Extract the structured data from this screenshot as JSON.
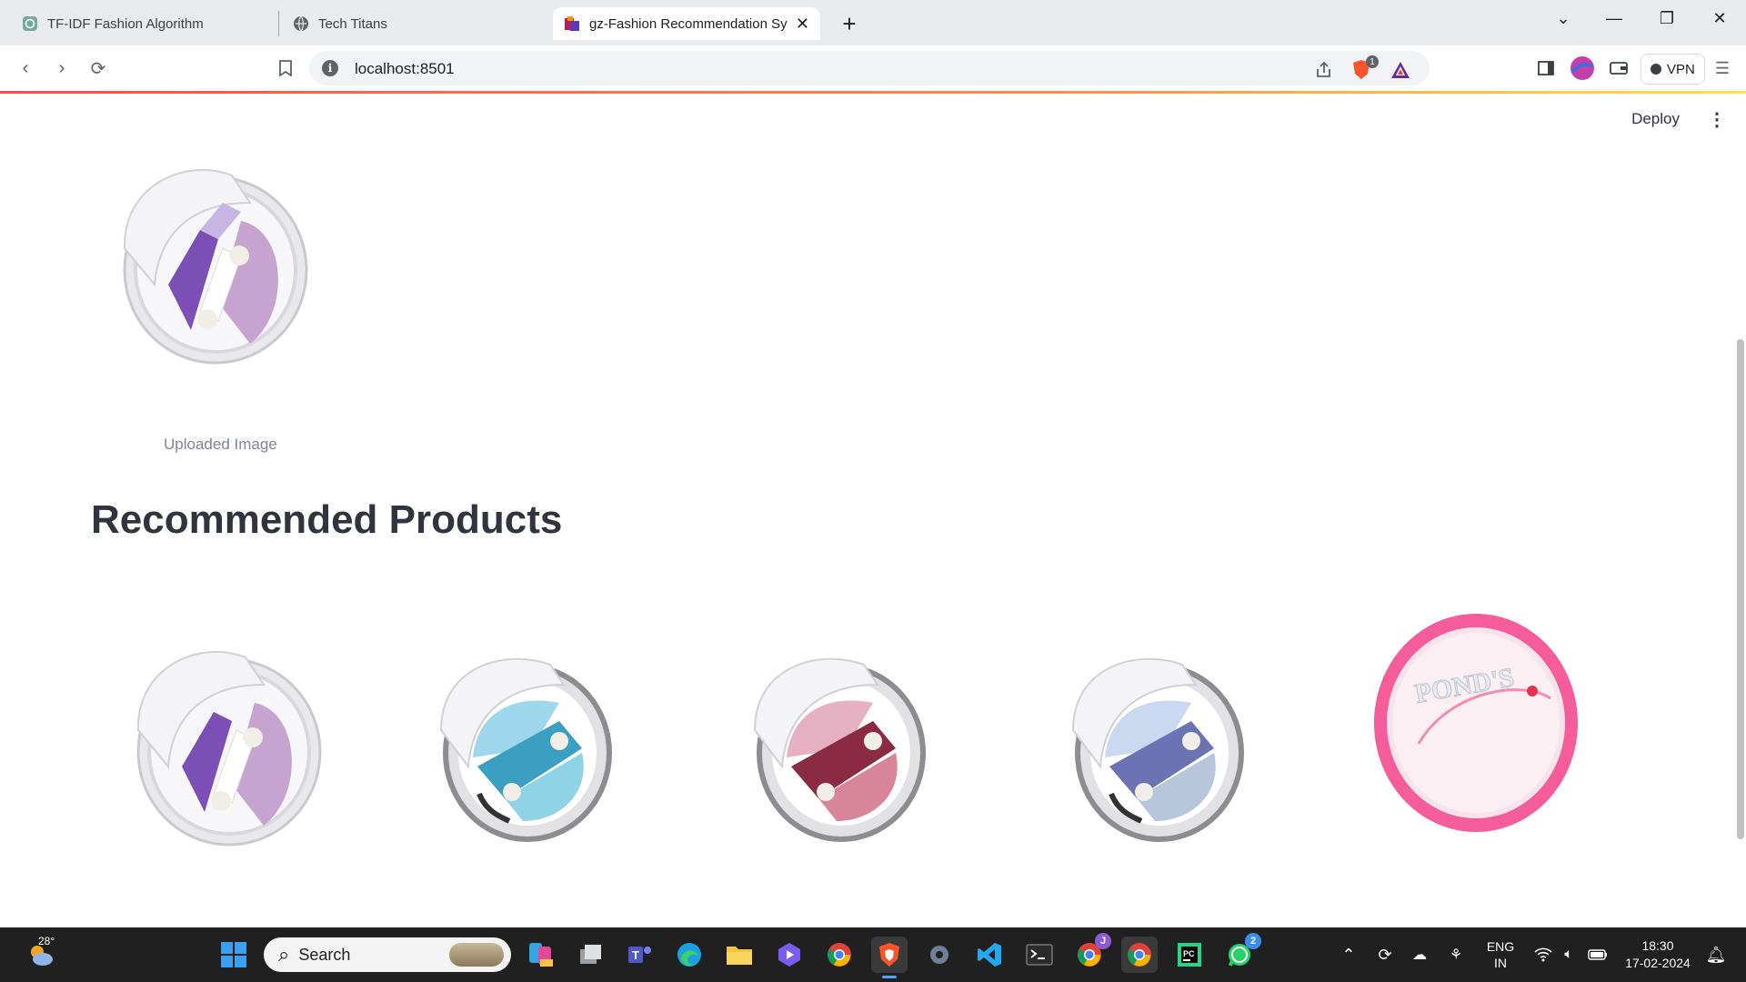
{
  "browser": {
    "tabs": [
      {
        "title": "TF-IDF Fashion Algorithm",
        "icon": "chatgpt-icon"
      },
      {
        "title": "Tech Titans",
        "icon": "globe-icon"
      },
      {
        "title": "gz-Fashion Recommendation Sy",
        "icon": "streamlit-icon",
        "active": true
      }
    ],
    "url": "localhost:8501",
    "brave_badge_count": "1",
    "vpn_label": "VPN"
  },
  "app": {
    "deploy_label": "Deploy",
    "uploaded_caption": "Uploaded Image",
    "section_heading": "Recommended Products",
    "products": [
      {
        "kind": "eyeshadow-compact",
        "color": "#7b4fb6",
        "color2": "#c7a3cf"
      },
      {
        "kind": "eyeshadow-compact",
        "color": "#3a9fc1",
        "color2": "#8fd3e6"
      },
      {
        "kind": "eyeshadow-compact",
        "color": "#8b2a44",
        "color2": "#d8859a"
      },
      {
        "kind": "eyeshadow-compact",
        "color": "#6c73b5",
        "color2": "#b8c6dc"
      },
      {
        "kind": "cream-jar",
        "brand_text": "POND'S",
        "color": "#f45c9a"
      }
    ]
  },
  "taskbar": {
    "weather_temp": "28°",
    "search_placeholder": "Search",
    "whatsapp_badge": "2",
    "chrome_badge": "J",
    "language": "ENG",
    "region": "IN",
    "time": "18:30",
    "date": "17-02-2024"
  }
}
